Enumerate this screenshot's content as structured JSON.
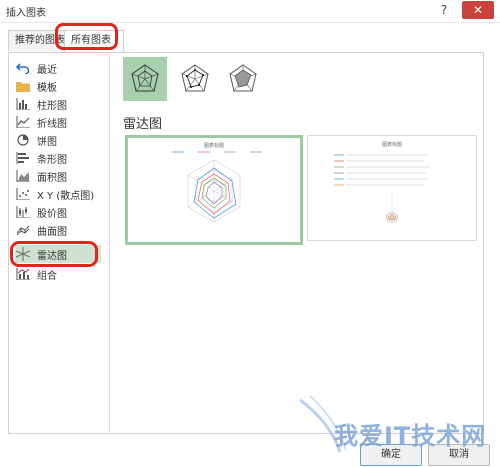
{
  "window": {
    "title": "插入图表",
    "help": "?",
    "close": "✕"
  },
  "tabs": [
    {
      "label": "推荐的图表",
      "active": false
    },
    {
      "label": "所有图表",
      "active": true
    }
  ],
  "sidebar": {
    "items": [
      {
        "label": "最近",
        "icon": "undo-icon"
      },
      {
        "label": "模板",
        "icon": "folder-icon"
      },
      {
        "label": "柱形图",
        "icon": "column-chart-icon"
      },
      {
        "label": "折线图",
        "icon": "line-chart-icon"
      },
      {
        "label": "饼图",
        "icon": "pie-chart-icon"
      },
      {
        "label": "条形图",
        "icon": "bar-chart-icon"
      },
      {
        "label": "面积图",
        "icon": "area-chart-icon"
      },
      {
        "label": "X Y (散点图)",
        "icon": "scatter-chart-icon"
      },
      {
        "label": "股价图",
        "icon": "stock-chart-icon"
      },
      {
        "label": "曲面图",
        "icon": "surface-chart-icon"
      },
      {
        "label": "雷达图",
        "icon": "radar-chart-icon",
        "selected": true
      },
      {
        "label": "组合",
        "icon": "combo-chart-icon"
      }
    ]
  },
  "main": {
    "section_title": "雷达图",
    "subtypes": [
      "radar",
      "radar-with-markers",
      "filled-radar"
    ],
    "preview1": {
      "title": "图表标题"
    },
    "preview2": {
      "title": "图表标题"
    }
  },
  "footer": {
    "ok": "确定",
    "cancel": "取消"
  },
  "watermark": {
    "text": "我爱IT技术网"
  },
  "colors": {
    "accent": "#9ccaa2",
    "selected": "#a8cfae",
    "highlight": "#e0261c"
  }
}
